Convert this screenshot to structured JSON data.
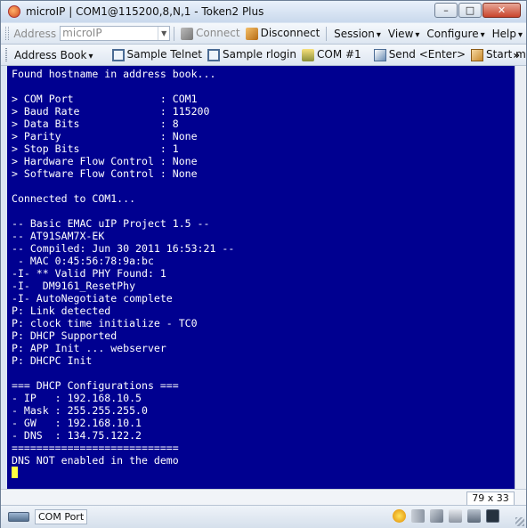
{
  "window": {
    "title": "microIP | COM1@115200,8,N,1 - Token2 Plus",
    "min_glyph": "–",
    "max_glyph": "□",
    "close_glyph": "✕"
  },
  "toolbar1": {
    "address_label": "Address",
    "address_value": "microIP",
    "connect": "Connect",
    "disconnect": "Disconnect",
    "menus": [
      "Session",
      "View",
      "Configure",
      "Help"
    ]
  },
  "toolbar2": {
    "address_book": "Address Book",
    "sample_telnet": "Sample Telnet",
    "sample_rlogin": "Sample rlogin",
    "com1": "COM #1",
    "send_enter": "Send <Enter>",
    "start_midc": "Start midc",
    "overflow": "»"
  },
  "terminal": {
    "lines": [
      "Found hostname in address book...",
      "",
      "> COM Port              : COM1",
      "> Baud Rate             : 115200",
      "> Data Bits             : 8",
      "> Parity                : None",
      "> Stop Bits             : 1",
      "> Hardware Flow Control : None",
      "> Software Flow Control : None",
      "",
      "Connected to COM1...",
      "",
      "-- Basic EMAC uIP Project 1.5 --",
      "-- AT91SAM7X-EK",
      "-- Compiled: Jun 30 2011 16:53:21 --",
      " - MAC 0:45:56:78:9a:bc",
      "-I- ** Valid PHY Found: 1",
      "-I-  DM9161_ResetPhy",
      "-I- AutoNegotiate complete",
      "P: Link detected",
      "P: clock time initialize - TC0",
      "P: DHCP Supported",
      "P: APP Init ... webserver",
      "P: DHCPC Init",
      "",
      "=== DHCP Configurations ===",
      "- IP   : 192.168.10.5",
      "- Mask : 255.255.255.0",
      "- GW   : 192.168.10.1",
      "- DNS  : 134.75.122.2",
      "===========================",
      "DNS NOT enabled in the demo"
    ],
    "background": "#000090",
    "foreground": "#ffffff",
    "cursor_color": "#ffff40"
  },
  "terminal_size": "79 x 33",
  "statusbar": {
    "port_label": "COM Port"
  }
}
